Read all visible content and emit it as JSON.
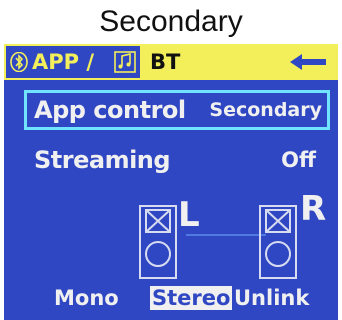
{
  "caption": "Secondary",
  "tabs": {
    "app_tab_label": "APP /",
    "bt_tab_label": "BT",
    "bt_icon": "bluetooth-icon",
    "music_icon": "music-note-icon",
    "back_icon": "back-arrow-icon"
  },
  "rows": {
    "app_control": {
      "label": "App control",
      "value": "Secondary"
    },
    "streaming": {
      "label": "Streaming",
      "value": "Off"
    }
  },
  "speakers": {
    "left_label": "L",
    "right_label": "R"
  },
  "modes": {
    "mono": "Mono",
    "stereo": "Stereo",
    "unlink": "Unlink",
    "selected": "Stereo"
  },
  "colors": {
    "screen_bg": "#2f47c3",
    "tab_bar": "#f3ef5a",
    "focus_outline": "#6fe3ff",
    "text": "#f0f0f0"
  }
}
